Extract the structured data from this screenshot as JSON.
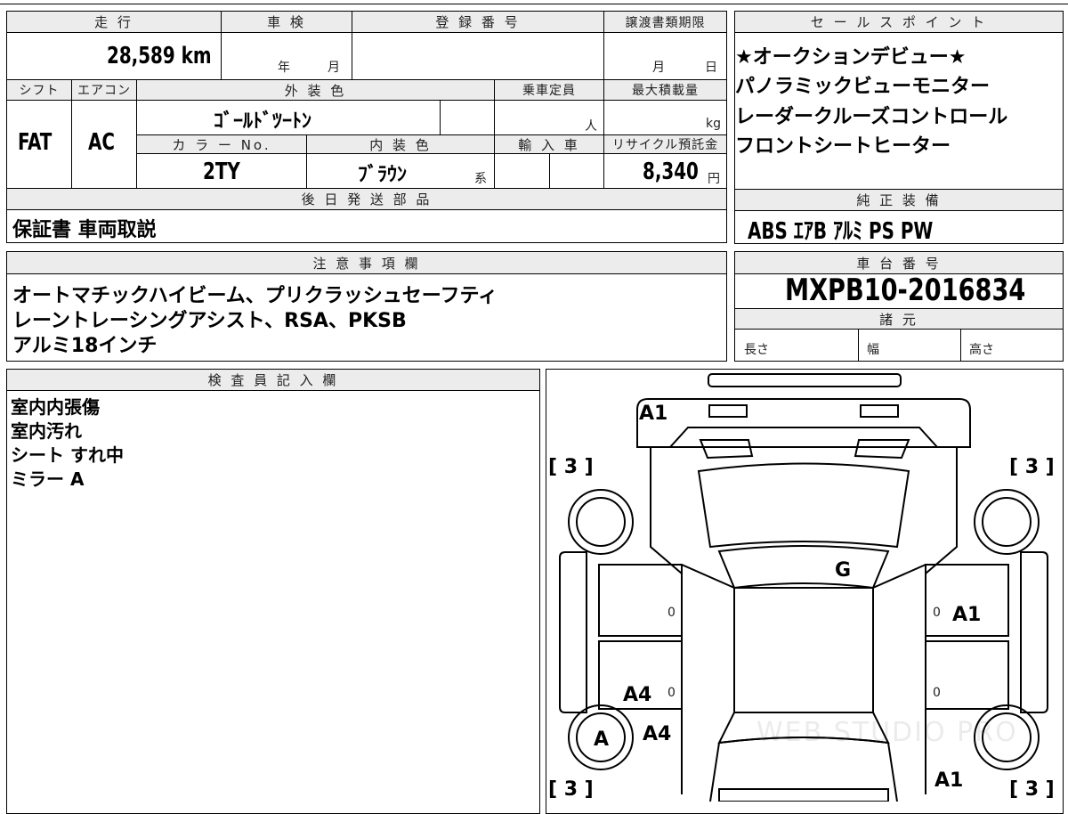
{
  "top_strip": {
    "partial_text": ""
  },
  "vehicle": {
    "mileage_label": "走 行",
    "mileage": "28,589 km",
    "inspection_label": "車 検",
    "inspection_year_unit": "年",
    "inspection_month_unit": "月",
    "registration_label": "登 録 番 号",
    "registration": "",
    "transfer_deadline_label": "譲渡書類期限",
    "transfer_month_unit": "月",
    "transfer_day_unit": "日",
    "shift_label": "シフト",
    "shift": "FAT",
    "ac_label": "エアコン",
    "ac": "AC",
    "exterior_color_label": "外 装 色",
    "exterior_color": "ｺﾞｰﾙﾄﾞﾂｰﾄﾝ",
    "capacity_label": "乗車定員",
    "capacity_unit": "人",
    "max_load_label": "最大積載量",
    "max_load_unit": "kg",
    "color_no_label": "カ ラ ー No.",
    "color_no": "2TY",
    "interior_color_label": "内 装 色",
    "interior_color": "ﾌﾞﾗｳﾝ",
    "interior_suffix": "系",
    "import_label": "輸 入 車",
    "recycle_label": "リサイクル預託金",
    "recycle_fee": "8,340",
    "recycle_unit": "円"
  },
  "sales_points": {
    "label": "セ ー ル ス ポ イ ン ト",
    "items": [
      "★オークションデビュー★",
      "パノラミックビューモニター",
      "レーダークルーズコントロール",
      "フロントシートヒーター"
    ]
  },
  "later_parts": {
    "label": "後 日 発 送 部 品",
    "text": "保証書 車両取説"
  },
  "genuine_equipment": {
    "label": "純 正 装 備",
    "text": "ABS ｴｱB ｱﾙﾐ PS PW"
  },
  "notes": {
    "label": "注 意 事 項 欄",
    "lines": [
      "オートマチックハイビーム、プリクラッシュセーフティ",
      "レーントレーシングアシスト、RSA、PKSB",
      "アルミ18インチ"
    ]
  },
  "chassis": {
    "label": "車 台 番 号",
    "number": "MXPB10-2016834"
  },
  "specs": {
    "label": "諸 元",
    "length": "長さ",
    "width": "幅",
    "height": "高さ"
  },
  "inspector": {
    "label": "検 査 員 記 入 欄",
    "lines": [
      "室内内張傷",
      "室内汚れ",
      "シート すれ中",
      "ミラー A"
    ]
  },
  "diagram": {
    "marks": {
      "front_a1": "A1",
      "glass_g": "G",
      "right_door_a1": "A1",
      "left_rear_a4_a": "A4",
      "left_rear_a4_b": "A4",
      "left_rear_wheel_a": "A",
      "rear_right_a1": "A1",
      "tl": "[ 3 ]",
      "tr": "[ 3 ]",
      "bl": "[ 3 ]",
      "br": "[ 3 ]",
      "zero1": "0",
      "zero2": "0",
      "zero3": "0",
      "zero4": "0"
    },
    "watermark": "WEB STUDIO PRO"
  }
}
